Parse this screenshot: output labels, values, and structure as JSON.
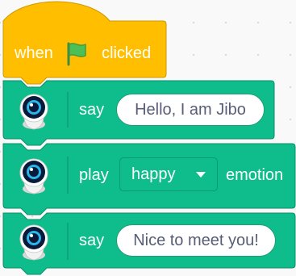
{
  "colors": {
    "event_block": "#ffbf00",
    "event_border": "#cc9900",
    "extension_block": "#0fbd8c",
    "extension_border": "#0b8e69",
    "flag": "#4cbf56",
    "input_text": "#575e75"
  },
  "hat_block": {
    "when_label": "when",
    "flag_icon": "green-flag-icon",
    "clicked_label": "clicked"
  },
  "blocks": [
    {
      "icon": "jibo-robot-icon",
      "label": "say",
      "input_value": "Hello, I am Jibo"
    },
    {
      "icon": "jibo-robot-icon",
      "label": "play",
      "dropdown_value": "happy",
      "suffix_label": "emotion"
    },
    {
      "icon": "jibo-robot-icon",
      "label": "say",
      "input_value": "Nice to meet you!"
    }
  ]
}
